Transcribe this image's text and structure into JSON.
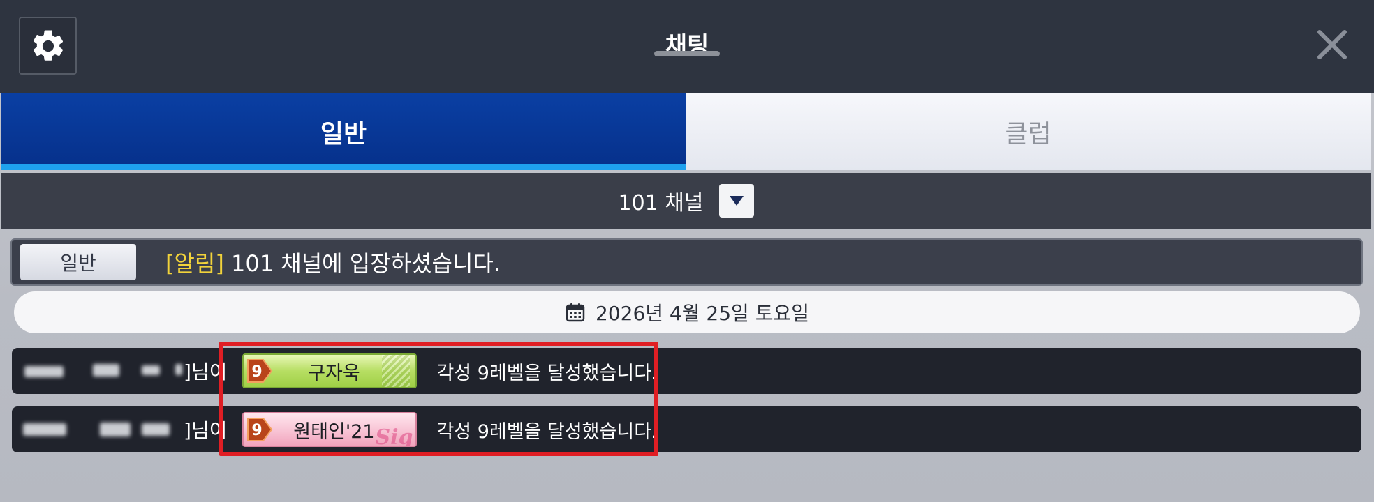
{
  "header": {
    "title": "채팅",
    "settings_icon": "gear-icon",
    "close_icon": "close-icon"
  },
  "tabs": [
    {
      "label": "일반",
      "active": true
    },
    {
      "label": "클럽",
      "active": false
    }
  ],
  "channel": {
    "label": "101 채널",
    "dropdown_icon": "triangle-down-icon"
  },
  "notice": {
    "badge": "일반",
    "tag": "[알림]",
    "text": " 101 채널에 입장하셨습니다."
  },
  "date": {
    "icon": "calendar-icon",
    "text": "2026년 4월 25일 토요일"
  },
  "chat": [
    {
      "user_suffix": "]님이",
      "level": "9",
      "player": "구자욱",
      "card_style": "green",
      "message": "각성 9레벨을 달성했습니다."
    },
    {
      "user_suffix": "]님이",
      "level": "9",
      "player": "원태인'21",
      "card_style": "pink",
      "card_mark": "Sig",
      "message": "각성 9레벨을 달성했습니다."
    }
  ],
  "colors": {
    "header_bg": "#2e3440",
    "tab_active_bg": "#0a3fa3",
    "tab_indicator": "#1ea1ee",
    "notice_tag": "#f2d33b",
    "highlight": "#e01e24"
  }
}
